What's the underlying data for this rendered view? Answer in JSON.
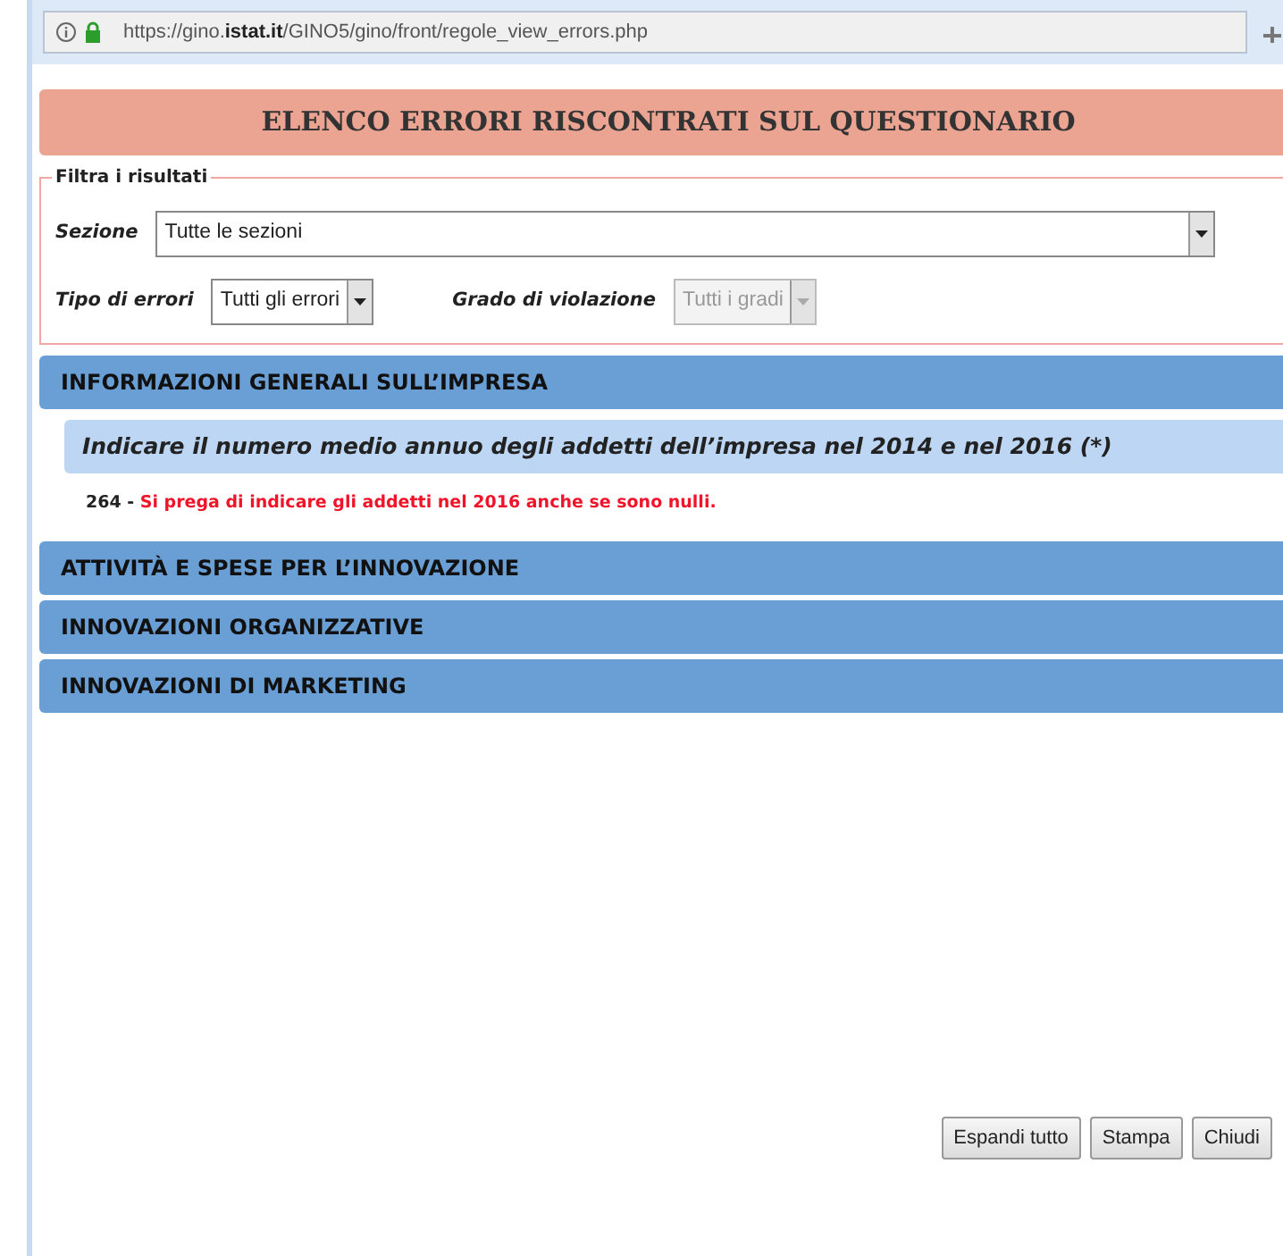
{
  "address_bar": {
    "url": "https://gino.**istat.it**/GINO5/gino/front/regole_view_errors.php"
  },
  "title": "ELENCO ERRORI RISCONTRATI SUL QUESTIONARIO",
  "filter": {
    "legend": "Filtra i risultati",
    "fields": [
      {
        "label": "Sezione",
        "value": "Tutte le sezioni",
        "disabled": false,
        "wide": true
      },
      {
        "label": "Tipo di errori",
        "value": "Tutti gli errori",
        "disabled": false,
        "wide": false
      },
      {
        "label": "Grado di violazione",
        "value": "Tutti i gradi",
        "disabled": true,
        "wide": false
      }
    ]
  },
  "sections": [
    {
      "title": "INFORMAZIONI GENERALI SULL’IMPRESA",
      "questions": [
        {
          "text": "Indicare il numero medio annuo degli addetti dell’impresa nel 2014 e nel 2016 (*)",
          "errors": [
            {
              "code": "264",
              "separator": "-",
              "message": "Si prega di indicare gli addetti nel 2016 anche se sono nulli."
            }
          ]
        }
      ]
    },
    {
      "title": "ATTIVITÀ E SPESE PER L’INNOVAZIONE"
    },
    {
      "title": "INNOVAZIONI ORGANIZZATIVE"
    },
    {
      "title": "INNOVAZIONI DI MARKETING"
    }
  ],
  "buttons": [
    "Espandi tutto",
    "Stampa",
    "Chiudi"
  ]
}
